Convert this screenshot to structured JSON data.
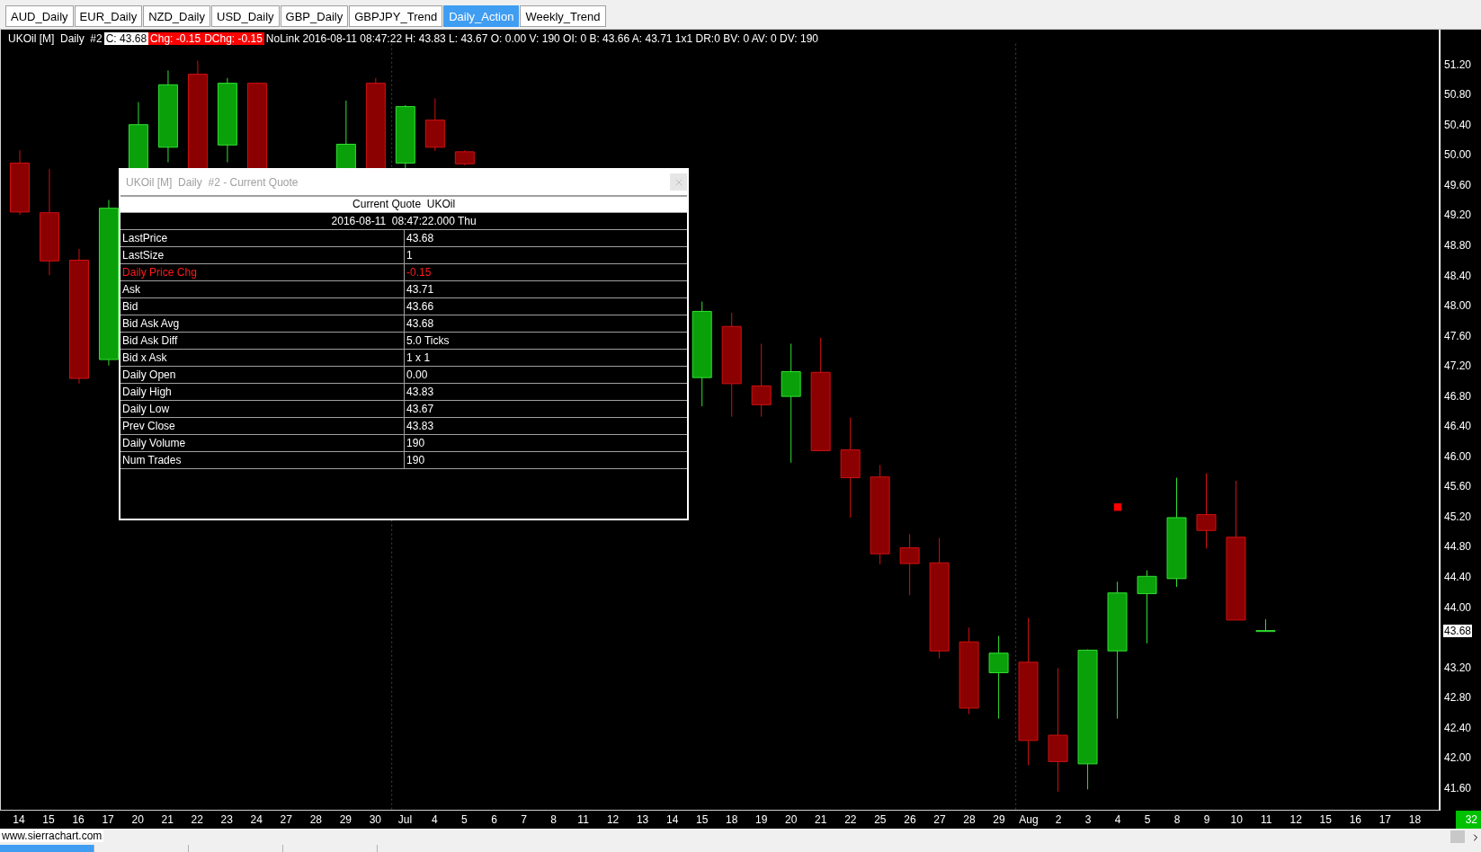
{
  "tabs": [
    {
      "label": "AUD_Daily",
      "selected": false
    },
    {
      "label": "EUR_Daily",
      "selected": false
    },
    {
      "label": "NZD_Daily",
      "selected": false
    },
    {
      "label": "USD_Daily",
      "selected": false
    },
    {
      "label": "GBP_Daily",
      "selected": false
    },
    {
      "label": "GBPJPY_Trend",
      "selected": false
    },
    {
      "label": "Daily_Action",
      "selected": true
    },
    {
      "label": "Weekly_Trend",
      "selected": false
    }
  ],
  "info_line": [
    {
      "text": "UKOil [M]  Daily  #2",
      "kind": "plain"
    },
    {
      "text": "C: 43.68",
      "kind": "inverse"
    },
    {
      "text": "Chg: -0.15",
      "kind": "alert"
    },
    {
      "text": "DChg: -0.15",
      "kind": "alert"
    },
    {
      "text": "NoLink 2016-08-11 08:47:22 H: 43.83 L: 43.67 O: 0.00 V: 190 OI: 0 B: 43.66 A: 43.71 1x1 DR:0 BV: 0 AV: 0 DV: 190",
      "kind": "plain"
    }
  ],
  "quote_window": {
    "title": "UKOil [M]  Daily  #2 - Current Quote",
    "heading": "Current Quote  UKOil",
    "timestamp": "2016-08-11  08:47:22.000 Thu",
    "rows": [
      {
        "label": "LastPrice",
        "value": "43.68",
        "kind": "normal"
      },
      {
        "label": "LastSize",
        "value": "1",
        "kind": "normal"
      },
      {
        "label": "Daily Price Chg",
        "value": "-0.15",
        "kind": "alert"
      },
      {
        "label": "Ask",
        "value": "43.71",
        "kind": "normal"
      },
      {
        "label": "Bid",
        "value": "43.66",
        "kind": "normal"
      },
      {
        "label": "Bid Ask Avg",
        "value": "43.68",
        "kind": "normal"
      },
      {
        "label": "Bid Ask Diff",
        "value": "5.0 Ticks",
        "kind": "normal"
      },
      {
        "label": "Bid x Ask",
        "value": "1 x 1",
        "kind": "normal"
      },
      {
        "label": "Daily Open",
        "value": "0.00",
        "kind": "normal"
      },
      {
        "label": "Daily High",
        "value": "43.83",
        "kind": "normal"
      },
      {
        "label": "Daily Low",
        "value": "43.67",
        "kind": "normal"
      },
      {
        "label": "Prev Close",
        "value": "43.83",
        "kind": "normal"
      },
      {
        "label": "Daily Volume",
        "value": "190",
        "kind": "normal"
      },
      {
        "label": "Num Trades",
        "value": "190",
        "kind": "normal"
      }
    ]
  },
  "price_axis": {
    "upper_labels": [
      "51.20",
      "50.80",
      "50.40",
      "50.00",
      "49.60",
      "49.20",
      "48.80",
      "48.40",
      "48.00",
      "47.60",
      "47.20",
      "46.80",
      "46.40",
      "46.00",
      "45.60",
      "45.20",
      "44.80",
      "44.40",
      "44.00"
    ],
    "lower_labels": [
      "43.20",
      "42.80",
      "42.40",
      "42.00",
      "41.60"
    ],
    "last_price": "43.68"
  },
  "date_axis": {
    "labels": [
      "14",
      "15",
      "16",
      "17",
      "20",
      "21",
      "22",
      "23",
      "24",
      "27",
      "28",
      "29",
      "30",
      "Jul",
      "4",
      "5",
      "6",
      "7",
      "8",
      "11",
      "12",
      "13",
      "14",
      "15",
      "18",
      "19",
      "20",
      "21",
      "22",
      "25",
      "26",
      "27",
      "28",
      "29",
      "Aug",
      "2",
      "3",
      "4",
      "5",
      "8",
      "9",
      "10",
      "11",
      "12",
      "15",
      "16",
      "17",
      "18"
    ],
    "bar_count": "32"
  },
  "site_label": "www.sierrachart.com",
  "bottom_tabs": [
    {
      "selected": true
    },
    {
      "selected": false
    },
    {
      "selected": false
    },
    {
      "selected": false
    }
  ]
}
